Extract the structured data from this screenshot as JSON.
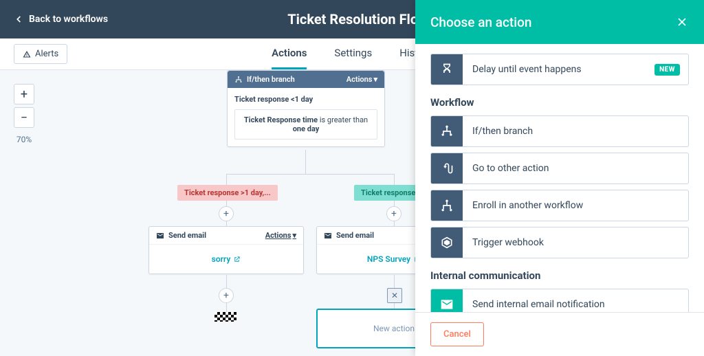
{
  "topbar": {
    "back": "Back to workflows",
    "title": "Ticket Resolution Flow"
  },
  "subbar": {
    "alerts": "Alerts",
    "tabs": [
      "Actions",
      "Settings",
      "History"
    ],
    "active_tab": 0
  },
  "zoom": {
    "level": "70%"
  },
  "branch": {
    "type_label": "If/then branch",
    "actions_label": "Actions",
    "subtitle": "Ticket response <1 day",
    "cond_prefix": "Ticket Response time",
    "cond_mid": "is greater than",
    "cond_suffix": "one day"
  },
  "pills": {
    "red": "Ticket response >1 day,...",
    "green": "Ticket response"
  },
  "email_left": {
    "head": "Send email",
    "actions": "Actions",
    "body": "sorry"
  },
  "email_right": {
    "head": "Send email",
    "body": "NPS Survey"
  },
  "new_action_placeholder": "New action",
  "panel": {
    "title": "Choose an action",
    "delay": {
      "label": "Delay until event happens",
      "badge": "NEW"
    },
    "sections": {
      "workflow": {
        "label": "Workflow",
        "items": [
          {
            "icon": "branch",
            "label": "If/then branch"
          },
          {
            "icon": "goto",
            "label": "Go to other action"
          },
          {
            "icon": "enroll",
            "label": "Enroll in another workflow"
          },
          {
            "icon": "webhook",
            "label": "Trigger webhook"
          }
        ]
      },
      "internal": {
        "label": "Internal communication",
        "items": [
          {
            "icon": "mail",
            "label": "Send internal email notification"
          }
        ]
      }
    },
    "cancel": "Cancel"
  }
}
